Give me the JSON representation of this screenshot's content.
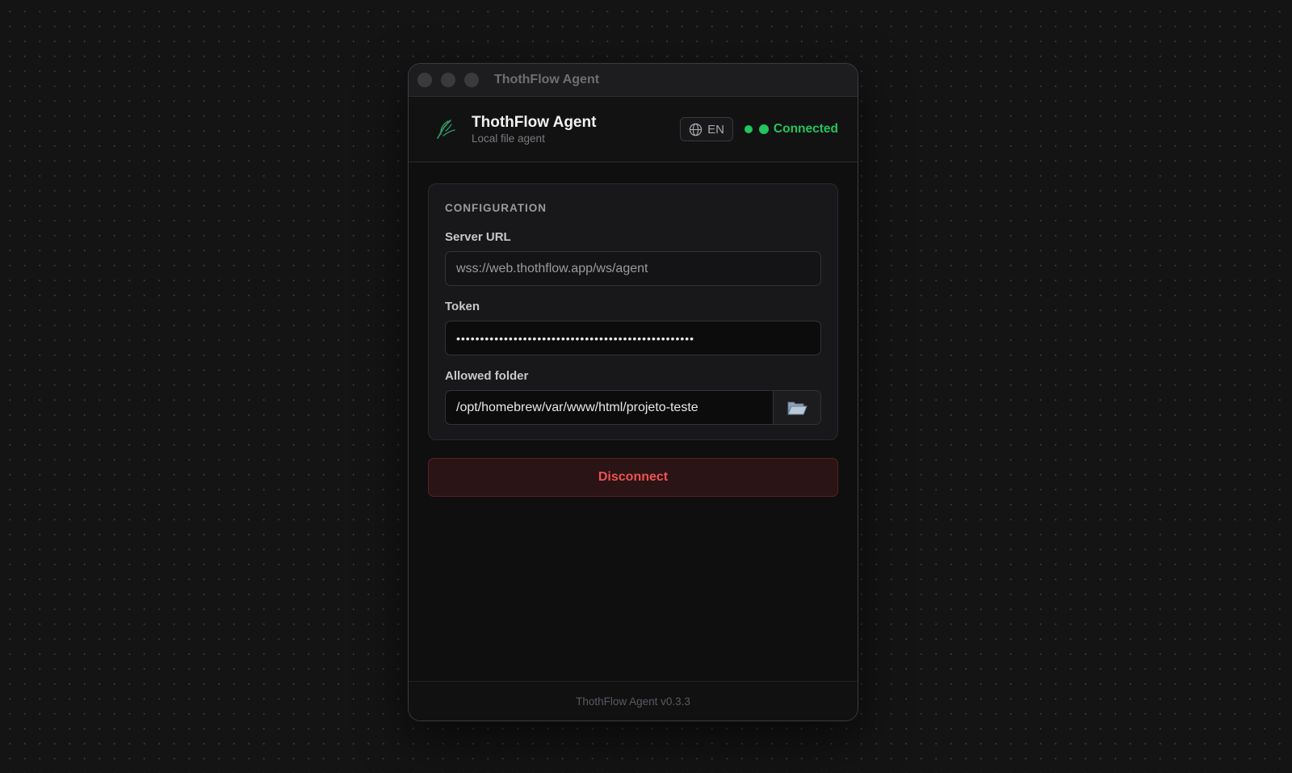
{
  "window": {
    "title": "ThothFlow Agent"
  },
  "header": {
    "app_name": "ThothFlow Agent",
    "subtitle": "Local file agent",
    "language": "EN",
    "status": "Connected",
    "logo_icon": "feather-logo-icon",
    "language_icon": "globe-icon"
  },
  "config": {
    "section_title": "CONFIGURATION",
    "server_url_label": "Server URL",
    "server_url_value": "wss://web.thothflow.app/ws/agent",
    "token_label": "Token",
    "token_value": "••••••••••••••••••••••••••••••••••••••••••••••••••",
    "folder_label": "Allowed folder",
    "folder_value": "/opt/homebrew/var/www/html/projeto-teste",
    "folder_button_icon": "folder-open-icon"
  },
  "actions": {
    "disconnect_label": "Disconnect"
  },
  "footer": {
    "version_text": "ThothFlow Agent v0.3.3"
  },
  "colors": {
    "accent_connected": "#22c55e",
    "danger": "#f05252",
    "background": "#141415"
  }
}
